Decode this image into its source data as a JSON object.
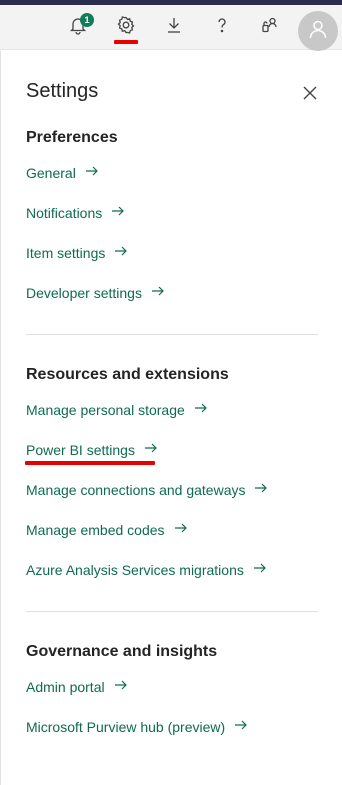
{
  "topbar": {
    "notifications_badge": "1",
    "icons": [
      "bell-icon",
      "gear-icon",
      "download-icon",
      "help-icon",
      "share-icon",
      "avatar-icon"
    ]
  },
  "settings": {
    "title": "Settings",
    "sections": [
      {
        "heading": "Preferences",
        "links": [
          "General",
          "Notifications",
          "Item settings",
          "Developer settings"
        ]
      },
      {
        "heading": "Resources and extensions",
        "links": [
          "Manage personal storage",
          "Power BI settings",
          "Manage connections and gateways",
          "Manage embed codes",
          "Azure Analysis Services migrations"
        ]
      },
      {
        "heading": "Governance and insights",
        "links": [
          "Admin portal",
          "Microsoft Purview hub (preview)"
        ]
      }
    ]
  },
  "colors": {
    "link": "#0e6b51",
    "badge": "#107c5a",
    "annotation": "#e60000"
  }
}
